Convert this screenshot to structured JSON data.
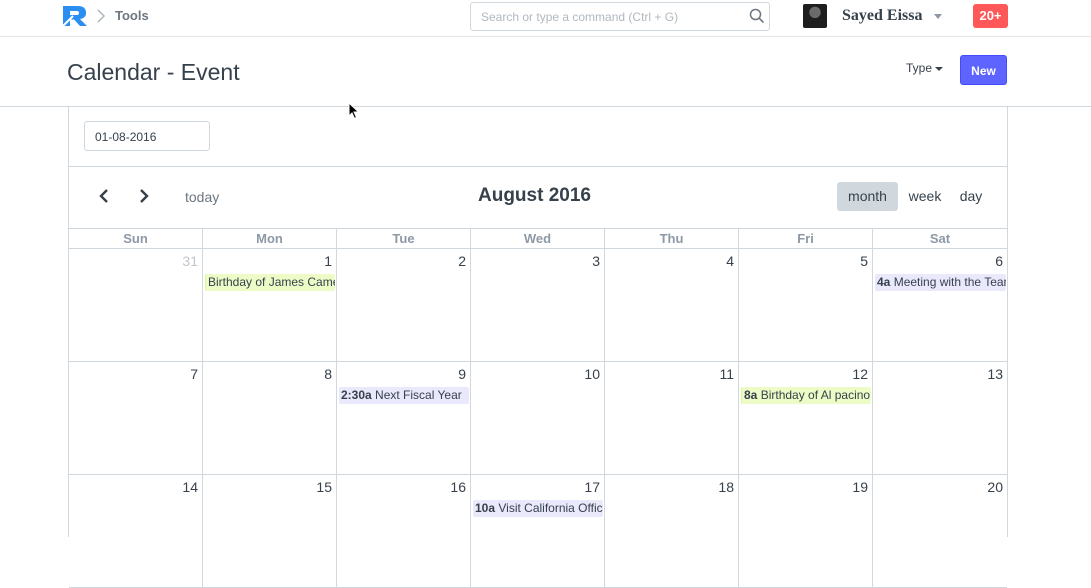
{
  "navbar": {
    "breadcrumb": "Tools",
    "search_placeholder": "Search or type a command (Ctrl + G)",
    "user_name": "Sayed Eissa",
    "notifications": "20+"
  },
  "page": {
    "title": "Calendar - Event",
    "type_label": "Type",
    "new_label": "New"
  },
  "calendar": {
    "date_value": "01-08-2016",
    "today_label": "today",
    "month_title": "August 2016",
    "views": {
      "month": "month",
      "week": "week",
      "day": "day"
    },
    "days_of_week": [
      "Sun",
      "Mon",
      "Tue",
      "Wed",
      "Thu",
      "Fri",
      "Sat"
    ],
    "weeks": [
      {
        "days": [
          {
            "num": "31",
            "other": true
          },
          {
            "num": "1",
            "event": {
              "time": "",
              "title": "Birthday of James Cameron",
              "color": "green"
            }
          },
          {
            "num": "2"
          },
          {
            "num": "3"
          },
          {
            "num": "4"
          },
          {
            "num": "5"
          },
          {
            "num": "6",
            "event": {
              "time": "4a",
              "title": "Meeting with the Team",
              "color": "purple"
            }
          }
        ]
      },
      {
        "days": [
          {
            "num": "7"
          },
          {
            "num": "8"
          },
          {
            "num": "9",
            "event": {
              "time": "2:30a",
              "title": "Next Fiscal Year",
              "color": "purple"
            }
          },
          {
            "num": "10"
          },
          {
            "num": "11"
          },
          {
            "num": "12",
            "event": {
              "time": "8a",
              "title": "Birthday of Al pacino",
              "color": "green"
            }
          },
          {
            "num": "13"
          }
        ]
      },
      {
        "days": [
          {
            "num": "14"
          },
          {
            "num": "15"
          },
          {
            "num": "16"
          },
          {
            "num": "17",
            "event": {
              "time": "10a",
              "title": "Visit California Office",
              "color": "purple"
            }
          },
          {
            "num": "18"
          },
          {
            "num": "19"
          },
          {
            "num": "20"
          }
        ]
      }
    ]
  },
  "colors": {
    "primary": "#5e64ff",
    "badge": "#ff5858",
    "event_green": "#edfcc6",
    "event_purple": "#eae8fb"
  }
}
